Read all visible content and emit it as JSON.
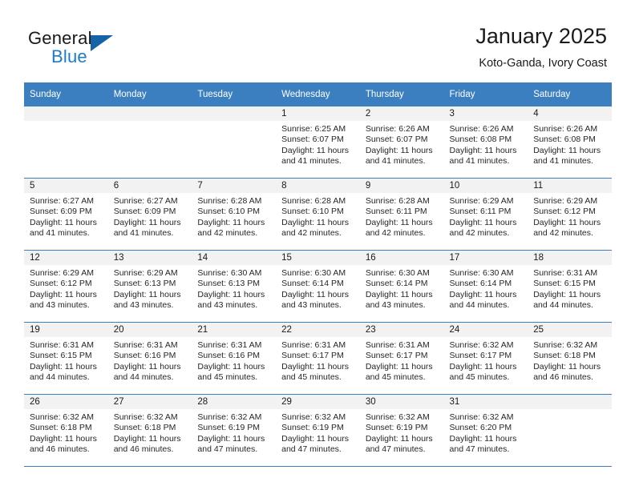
{
  "brand": {
    "name_part1": "General",
    "name_part2": "Blue",
    "color_dark": "#1a1a1a",
    "color_blue": "#1e7bc8",
    "triangle_color": "#1763a8"
  },
  "header": {
    "title": "January 2025",
    "subtitle": "Koto-Ganda, Ivory Coast"
  },
  "theme": {
    "header_row_bg": "#3c7fc1",
    "header_row_text": "#ffffff",
    "daynum_bg": "#f2f2f2",
    "grid_line": "#3c7fc1",
    "body_text": "#262626"
  },
  "weekday_headers": [
    "Sunday",
    "Monday",
    "Tuesday",
    "Wednesday",
    "Thursday",
    "Friday",
    "Saturday"
  ],
  "weeks": [
    [
      {
        "day": "",
        "lines": []
      },
      {
        "day": "",
        "lines": []
      },
      {
        "day": "",
        "lines": []
      },
      {
        "day": "1",
        "lines": [
          "Sunrise: 6:25 AM",
          "Sunset: 6:07 PM",
          "Daylight: 11 hours",
          "and 41 minutes."
        ]
      },
      {
        "day": "2",
        "lines": [
          "Sunrise: 6:26 AM",
          "Sunset: 6:07 PM",
          "Daylight: 11 hours",
          "and 41 minutes."
        ]
      },
      {
        "day": "3",
        "lines": [
          "Sunrise: 6:26 AM",
          "Sunset: 6:08 PM",
          "Daylight: 11 hours",
          "and 41 minutes."
        ]
      },
      {
        "day": "4",
        "lines": [
          "Sunrise: 6:26 AM",
          "Sunset: 6:08 PM",
          "Daylight: 11 hours",
          "and 41 minutes."
        ]
      }
    ],
    [
      {
        "day": "5",
        "lines": [
          "Sunrise: 6:27 AM",
          "Sunset: 6:09 PM",
          "Daylight: 11 hours",
          "and 41 minutes."
        ]
      },
      {
        "day": "6",
        "lines": [
          "Sunrise: 6:27 AM",
          "Sunset: 6:09 PM",
          "Daylight: 11 hours",
          "and 41 minutes."
        ]
      },
      {
        "day": "7",
        "lines": [
          "Sunrise: 6:28 AM",
          "Sunset: 6:10 PM",
          "Daylight: 11 hours",
          "and 42 minutes."
        ]
      },
      {
        "day": "8",
        "lines": [
          "Sunrise: 6:28 AM",
          "Sunset: 6:10 PM",
          "Daylight: 11 hours",
          "and 42 minutes."
        ]
      },
      {
        "day": "9",
        "lines": [
          "Sunrise: 6:28 AM",
          "Sunset: 6:11 PM",
          "Daylight: 11 hours",
          "and 42 minutes."
        ]
      },
      {
        "day": "10",
        "lines": [
          "Sunrise: 6:29 AM",
          "Sunset: 6:11 PM",
          "Daylight: 11 hours",
          "and 42 minutes."
        ]
      },
      {
        "day": "11",
        "lines": [
          "Sunrise: 6:29 AM",
          "Sunset: 6:12 PM",
          "Daylight: 11 hours",
          "and 42 minutes."
        ]
      }
    ],
    [
      {
        "day": "12",
        "lines": [
          "Sunrise: 6:29 AM",
          "Sunset: 6:12 PM",
          "Daylight: 11 hours",
          "and 43 minutes."
        ]
      },
      {
        "day": "13",
        "lines": [
          "Sunrise: 6:29 AM",
          "Sunset: 6:13 PM",
          "Daylight: 11 hours",
          "and 43 minutes."
        ]
      },
      {
        "day": "14",
        "lines": [
          "Sunrise: 6:30 AM",
          "Sunset: 6:13 PM",
          "Daylight: 11 hours",
          "and 43 minutes."
        ]
      },
      {
        "day": "15",
        "lines": [
          "Sunrise: 6:30 AM",
          "Sunset: 6:14 PM",
          "Daylight: 11 hours",
          "and 43 minutes."
        ]
      },
      {
        "day": "16",
        "lines": [
          "Sunrise: 6:30 AM",
          "Sunset: 6:14 PM",
          "Daylight: 11 hours",
          "and 43 minutes."
        ]
      },
      {
        "day": "17",
        "lines": [
          "Sunrise: 6:30 AM",
          "Sunset: 6:14 PM",
          "Daylight: 11 hours",
          "and 44 minutes."
        ]
      },
      {
        "day": "18",
        "lines": [
          "Sunrise: 6:31 AM",
          "Sunset: 6:15 PM",
          "Daylight: 11 hours",
          "and 44 minutes."
        ]
      }
    ],
    [
      {
        "day": "19",
        "lines": [
          "Sunrise: 6:31 AM",
          "Sunset: 6:15 PM",
          "Daylight: 11 hours",
          "and 44 minutes."
        ]
      },
      {
        "day": "20",
        "lines": [
          "Sunrise: 6:31 AM",
          "Sunset: 6:16 PM",
          "Daylight: 11 hours",
          "and 44 minutes."
        ]
      },
      {
        "day": "21",
        "lines": [
          "Sunrise: 6:31 AM",
          "Sunset: 6:16 PM",
          "Daylight: 11 hours",
          "and 45 minutes."
        ]
      },
      {
        "day": "22",
        "lines": [
          "Sunrise: 6:31 AM",
          "Sunset: 6:17 PM",
          "Daylight: 11 hours",
          "and 45 minutes."
        ]
      },
      {
        "day": "23",
        "lines": [
          "Sunrise: 6:31 AM",
          "Sunset: 6:17 PM",
          "Daylight: 11 hours",
          "and 45 minutes."
        ]
      },
      {
        "day": "24",
        "lines": [
          "Sunrise: 6:32 AM",
          "Sunset: 6:17 PM",
          "Daylight: 11 hours",
          "and 45 minutes."
        ]
      },
      {
        "day": "25",
        "lines": [
          "Sunrise: 6:32 AM",
          "Sunset: 6:18 PM",
          "Daylight: 11 hours",
          "and 46 minutes."
        ]
      }
    ],
    [
      {
        "day": "26",
        "lines": [
          "Sunrise: 6:32 AM",
          "Sunset: 6:18 PM",
          "Daylight: 11 hours",
          "and 46 minutes."
        ]
      },
      {
        "day": "27",
        "lines": [
          "Sunrise: 6:32 AM",
          "Sunset: 6:18 PM",
          "Daylight: 11 hours",
          "and 46 minutes."
        ]
      },
      {
        "day": "28",
        "lines": [
          "Sunrise: 6:32 AM",
          "Sunset: 6:19 PM",
          "Daylight: 11 hours",
          "and 47 minutes."
        ]
      },
      {
        "day": "29",
        "lines": [
          "Sunrise: 6:32 AM",
          "Sunset: 6:19 PM",
          "Daylight: 11 hours",
          "and 47 minutes."
        ]
      },
      {
        "day": "30",
        "lines": [
          "Sunrise: 6:32 AM",
          "Sunset: 6:19 PM",
          "Daylight: 11 hours",
          "and 47 minutes."
        ]
      },
      {
        "day": "31",
        "lines": [
          "Sunrise: 6:32 AM",
          "Sunset: 6:20 PM",
          "Daylight: 11 hours",
          "and 47 minutes."
        ]
      },
      {
        "day": "",
        "lines": []
      }
    ]
  ]
}
